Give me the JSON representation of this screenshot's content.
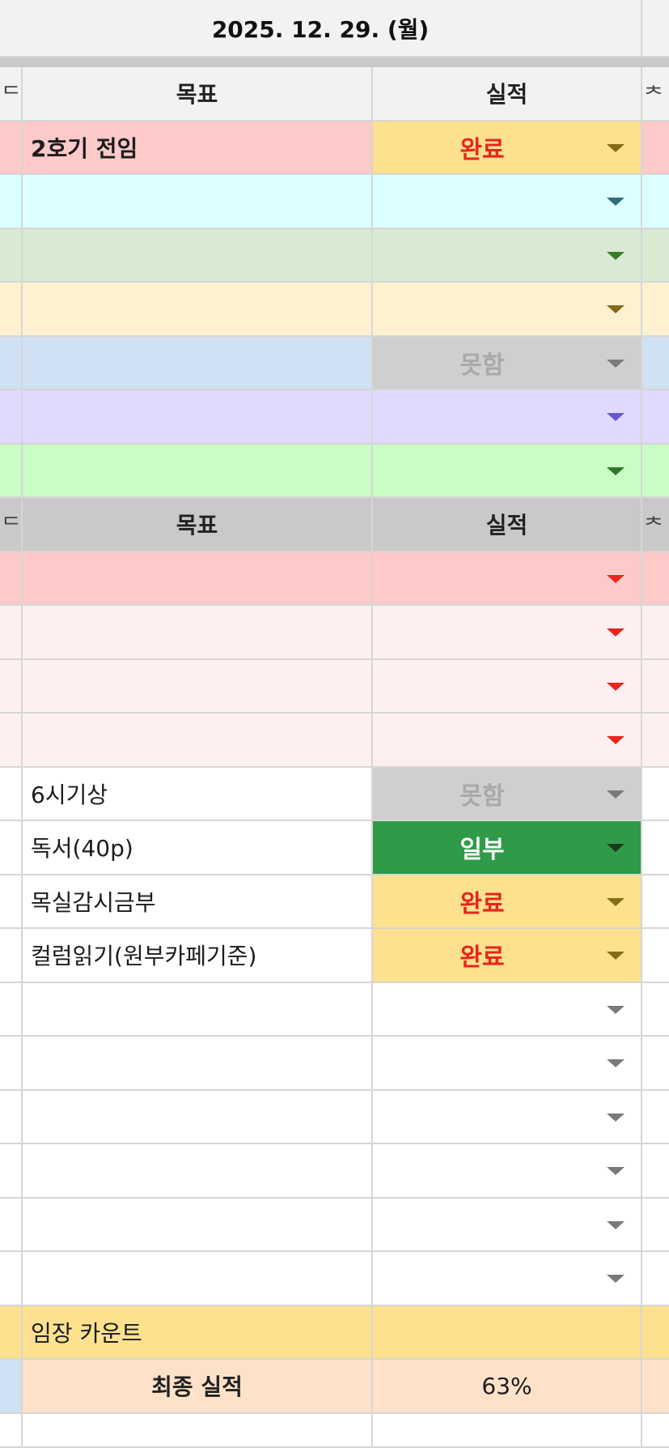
{
  "sheet": {
    "date": "2025. 12. 29. (월)",
    "edge_glyph_left": "ᄃ",
    "edge_glyph_right": "ᄎ",
    "section1": {
      "header": {
        "goal": "목표",
        "result": "실적"
      },
      "rows": [
        {
          "goal": "2호기 전임",
          "result": "완료",
          "bg": "#fdc9c9",
          "res_bg": "#fde18f",
          "res_color": "#e8261d",
          "arrow": "#8a6a16",
          "bold": true
        },
        {
          "goal": "",
          "result": "",
          "bg": "#dcffff",
          "res_bg": "#dcffff",
          "res_color": "#333333",
          "arrow": "#2f6e78"
        },
        {
          "goal": "",
          "result": "",
          "bg": "#d9ead3",
          "res_bg": "#d9ead3",
          "res_color": "#333333",
          "arrow": "#3c7a2b"
        },
        {
          "goal": "",
          "result": "",
          "bg": "#fef1cf",
          "res_bg": "#fef1cf",
          "res_color": "#333333",
          "arrow": "#8a6a16"
        },
        {
          "goal": "",
          "result": "못함",
          "bg": "#cfe1f3",
          "res_bg": "#cfcfcf",
          "res_color": "#a9a9a9",
          "arrow": "#7a7a7a"
        },
        {
          "goal": "",
          "result": "",
          "bg": "#e0daff",
          "res_bg": "#e0daff",
          "res_color": "#333333",
          "arrow": "#6658d8"
        },
        {
          "goal": "",
          "result": "",
          "bg": "#c8fdc4",
          "res_bg": "#c8fdc4",
          "res_color": "#333333",
          "arrow": "#2d7a25"
        }
      ]
    },
    "section2": {
      "header": {
        "goal": "목표",
        "result": "실적"
      },
      "rows": [
        {
          "goal": "",
          "result": "",
          "bg": "#fdc9c9",
          "res_bg": "#fdc9c9",
          "res_color": "#333333",
          "arrow": "#e8261d"
        },
        {
          "goal": "",
          "result": "",
          "bg": "#fff0f0",
          "res_bg": "#fff0f0",
          "res_color": "#333333",
          "arrow": "#e8261d"
        },
        {
          "goal": "",
          "result": "",
          "bg": "#fff0f0",
          "res_bg": "#fff0f0",
          "res_color": "#333333",
          "arrow": "#e8261d"
        },
        {
          "goal": "",
          "result": "",
          "bg": "#fff0f0",
          "res_bg": "#fff0f0",
          "res_color": "#333333",
          "arrow": "#e8261d"
        },
        {
          "goal": "6시기상",
          "result": "못함",
          "bg": "#ffffff",
          "res_bg": "#cfcfcf",
          "res_color": "#a9a9a9",
          "arrow": "#7a7a7a"
        },
        {
          "goal": "독서(40p)",
          "result": "일부",
          "bg": "#ffffff",
          "res_bg": "#2f9b48",
          "res_color": "#ffffff",
          "arrow": "#1a3a1f"
        },
        {
          "goal": "목실감시금부",
          "result": "완료",
          "bg": "#ffffff",
          "res_bg": "#fde18f",
          "res_color": "#e8261d",
          "arrow": "#8a6a16"
        },
        {
          "goal": "컬럼읽기(원부카페기준)",
          "result": "완료",
          "bg": "#ffffff",
          "res_bg": "#fde18f",
          "res_color": "#e8261d",
          "arrow": "#8a6a16"
        },
        {
          "goal": "",
          "result": "",
          "bg": "#ffffff",
          "res_bg": "#ffffff",
          "res_color": "#333333",
          "arrow": "#7a7a7a"
        },
        {
          "goal": "",
          "result": "",
          "bg": "#ffffff",
          "res_bg": "#ffffff",
          "res_color": "#333333",
          "arrow": "#7a7a7a"
        },
        {
          "goal": "",
          "result": "",
          "bg": "#ffffff",
          "res_bg": "#ffffff",
          "res_color": "#333333",
          "arrow": "#7a7a7a"
        },
        {
          "goal": "",
          "result": "",
          "bg": "#ffffff",
          "res_bg": "#ffffff",
          "res_color": "#333333",
          "arrow": "#7a7a7a"
        },
        {
          "goal": "",
          "result": "",
          "bg": "#ffffff",
          "res_bg": "#ffffff",
          "res_color": "#333333",
          "arrow": "#7a7a7a"
        },
        {
          "goal": "",
          "result": "",
          "bg": "#ffffff",
          "res_bg": "#ffffff",
          "res_color": "#333333",
          "arrow": "#7a7a7a"
        }
      ]
    },
    "count_row": {
      "label": "임장 카운트"
    },
    "final_row": {
      "label": "최종 실적",
      "value": "63%"
    },
    "colors": {
      "header_bg": "#f2f2f2",
      "section2_header_bg": "#c9c9c9",
      "count_bg": "#fde18f",
      "final_bg": "#fde2c9",
      "grid": "#d6d6d6"
    }
  }
}
